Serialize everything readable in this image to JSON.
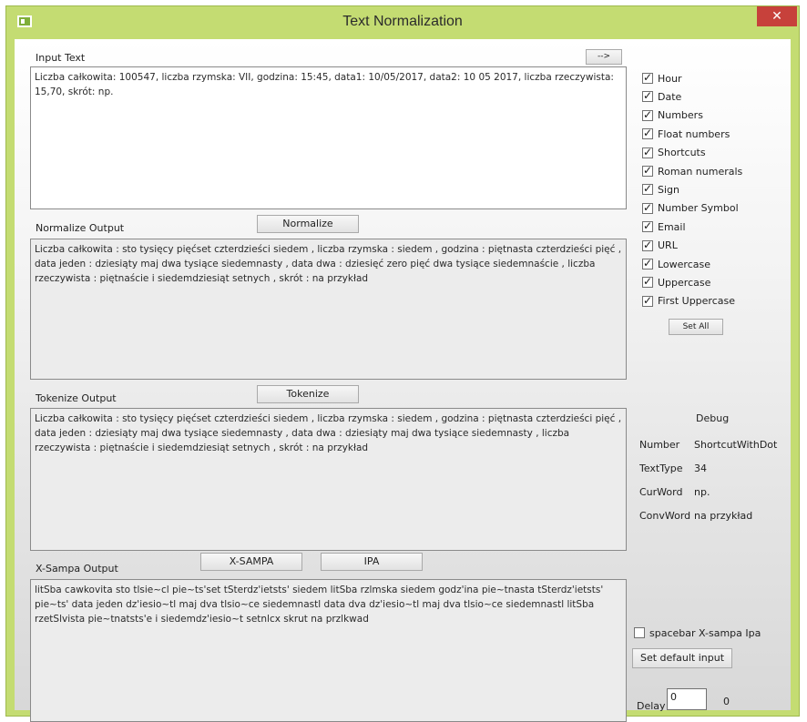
{
  "window": {
    "title": "Text Normalization",
    "close_glyph": "✕",
    "icon": "app-window-icon",
    "accent_color": "#c4dc72"
  },
  "input": {
    "label": "Input Text",
    "arrow_button": "-->",
    "value": "Liczba całkowita: 100547, liczba rzymska: VII, godzina: 15:45, data1: 10/05/2017, data2: 10 05 2017, liczba rzeczywista: 15,70, skrót: np."
  },
  "normalize": {
    "label": "Normalize Output",
    "button": "Normalize",
    "value": "Liczba całkowita : sto tysięcy pięćset czterdzieści siedem , liczba rzymska : siedem , godzina : piętnasta czterdzieści pięć , data jeden : dziesiąty maj dwa tysiące siedemnasty , data dwa : dziesięć zero pięć dwa tysiące siedemnaście , liczba rzeczywista : piętnaście i siedemdziesiąt setnych , skrót : na przykład"
  },
  "tokenize": {
    "label": "Tokenize Output",
    "button": "Tokenize",
    "value": "Liczba całkowita : sto tysięcy pięćset czterdzieści siedem , liczba rzymska : siedem , godzina : piętnasta czterdzieści pięć , data jeden : dziesiąty maj dwa tysiące siedemnasty , data dwa : dziesiąty maj dwa tysiące siedemnasty , liczba rzeczywista : piętnaście i siedemdziesiąt setnych , skrót : na przykład"
  },
  "xsampa": {
    "label": "X-Sampa Output",
    "xsampa_button": "X-SAMPA",
    "ipa_button": "IPA",
    "value": "litSba cawkovita  sto tlsie~cl pie~ts'set tSterdz'ietsts' siedem  litSba rzlmska  siedem  godz'ina  pie~tnasta tSterdz'ietsts' pie~ts'  data jeden  dz'iesio~tl maj dva tlsio~ce siedemnastl  data dva  dz'iesio~tl maj dva tlsio~ce siedemnastl  litSba rzetSlvista  pie~tnatsts'e i siedemdz'iesio~t setnlcx  skrut  na przlkwad"
  },
  "options": [
    {
      "label": "Hour",
      "checked": true
    },
    {
      "label": "Date",
      "checked": true
    },
    {
      "label": "Numbers",
      "checked": true
    },
    {
      "label": "Float numbers",
      "checked": true
    },
    {
      "label": "Shortcuts",
      "checked": true
    },
    {
      "label": "Roman numerals",
      "checked": true
    },
    {
      "label": "Sign",
      "checked": true
    },
    {
      "label": "Number Symbol",
      "checked": true
    },
    {
      "label": "Email",
      "checked": true
    },
    {
      "label": "URL",
      "checked": true
    },
    {
      "label": "Lowercase",
      "checked": true
    },
    {
      "label": "Uppercase",
      "checked": true
    },
    {
      "label": "First Uppercase",
      "checked": true
    }
  ],
  "set_all_button": "Set All",
  "debug": {
    "header": "Debug",
    "number_label": "Number",
    "number_value": "ShortcutWithDot",
    "texttype_label": "TextType",
    "texttype_value": "34",
    "curword_label": "CurWord",
    "curword_value": "np.",
    "convword_label": "ConvWord",
    "convword_value": "na przykład"
  },
  "spacebar_checkbox": {
    "label": "spacebar X-sampa Ipa",
    "checked": false
  },
  "set_default_button": "Set default input",
  "delay": {
    "label": "Delay",
    "value": "0",
    "readout": "0"
  }
}
